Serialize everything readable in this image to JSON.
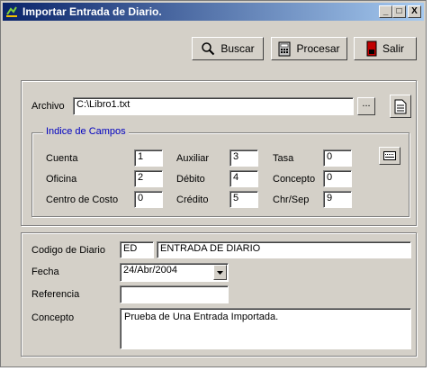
{
  "window": {
    "title": "Importar Entrada de Diario."
  },
  "titlebar_buttons": {
    "minimize": "_",
    "maximize": "□",
    "close": "X"
  },
  "toolbar": {
    "buscar": "Buscar",
    "procesar": "Procesar",
    "salir": "Salir"
  },
  "archivo": {
    "label": "Archivo",
    "value": "C:\\Libro1.txt",
    "browse_label": "..."
  },
  "indice": {
    "title": "Indice de Campos",
    "cuenta": {
      "label": "Cuenta",
      "value": "1"
    },
    "oficina": {
      "label": "Oficina",
      "value": "2"
    },
    "centro": {
      "label": "Centro de Costo",
      "value": "0"
    },
    "auxiliar": {
      "label": "Auxiliar",
      "value": "3"
    },
    "debito": {
      "label": "Débito",
      "value": "4"
    },
    "credito": {
      "label": "Crédito",
      "value": "5"
    },
    "tasa": {
      "label": "Tasa",
      "value": "0"
    },
    "concepto": {
      "label": "Concepto",
      "value": "0"
    },
    "chrsep": {
      "label": "Chr/Sep",
      "value": "9"
    }
  },
  "diario": {
    "codigo_label": "Codigo de Diario",
    "codigo_value": "ED",
    "nombre_value": "ENTRADA DE DIARIO",
    "fecha_label": "Fecha",
    "fecha_value": "24/Abr/2004",
    "referencia_label": "Referencia",
    "referencia_value": "",
    "concepto_label": "Concepto",
    "concepto_value": "Prueba de Una Entrada Importada."
  },
  "colors": {
    "title_start": "#0a246a",
    "title_end": "#a6caf0",
    "group_caption": "#0000c0",
    "face": "#d4d0c8"
  }
}
